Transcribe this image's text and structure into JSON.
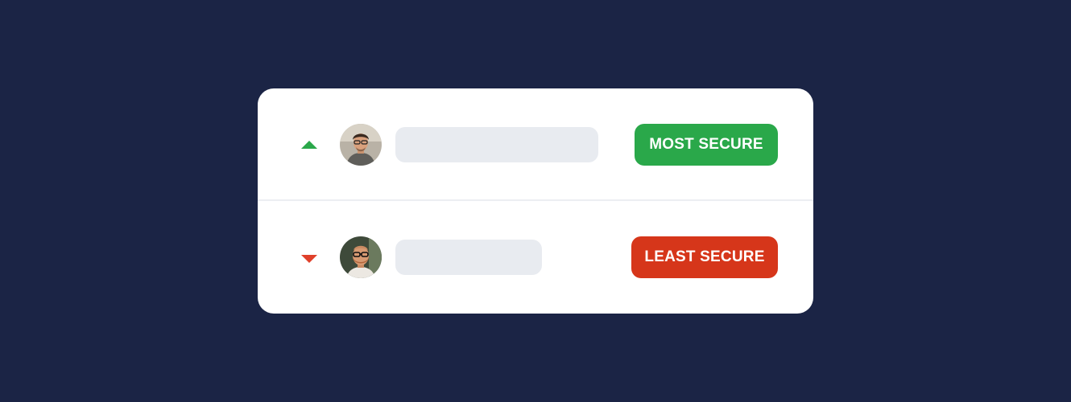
{
  "rows": [
    {
      "trend": "up",
      "trend_icon": "triangle-up-icon",
      "trend_color": "#2aa84a",
      "avatar": "avatar-photo-man-glasses",
      "badge_label": "MOST SECURE",
      "badge_color": "#2aa84a"
    },
    {
      "trend": "down",
      "trend_icon": "triangle-down-icon",
      "trend_color": "#e0402a",
      "avatar": "avatar-photo-man-beard-glasses",
      "badge_label": "LEAST SECURE",
      "badge_color": "#d6361a"
    }
  ],
  "colors": {
    "background": "#1b2445",
    "card": "#ffffff",
    "placeholder": "#e8ebf0"
  }
}
